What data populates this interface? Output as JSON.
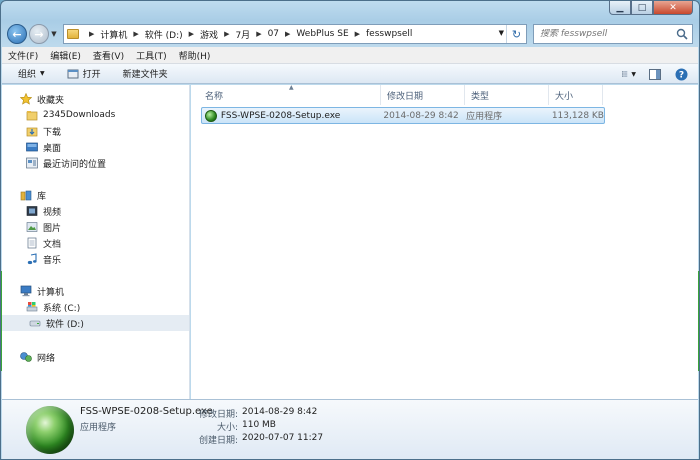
{
  "address": {
    "crumbs": [
      "计算机",
      "软件 (D:)",
      "游戏",
      "7月",
      "07",
      "WebPlus SE",
      "fesswpsell"
    ]
  },
  "search": {
    "placeholder": "搜索 fesswpsell"
  },
  "menu": {
    "items": [
      "文件(F)",
      "编辑(E)",
      "查看(V)",
      "工具(T)",
      "帮助(H)"
    ]
  },
  "toolbar": {
    "organize": "组织",
    "open": "打开",
    "new_folder": "新建文件夹"
  },
  "nav": {
    "favorites": {
      "label": "收藏夹",
      "items": [
        "2345Downloads",
        "下载",
        "桌面",
        "最近访问的位置"
      ]
    },
    "libraries": {
      "label": "库",
      "items": [
        "视频",
        "图片",
        "文档",
        "音乐"
      ]
    },
    "computer": {
      "label": "计算机",
      "items": [
        "系统 (C:)",
        "软件 (D:)"
      ]
    },
    "network": {
      "label": "网络"
    }
  },
  "columns": [
    "名称",
    "修改日期",
    "类型",
    "大小"
  ],
  "files": [
    {
      "name": "FSS-WPSE-0208-Setup.exe",
      "modified": "2014-08-29 8:42",
      "type": "应用程序",
      "size": "113,128 KB"
    }
  ],
  "details": {
    "name": "FSS-WPSE-0208-Setup.exe",
    "type": "应用程序",
    "modified_label": "修改日期:",
    "modified": "2014-08-29 8:42",
    "size_label": "大小:",
    "size": "110 MB",
    "created_label": "创建日期:",
    "created": "2020-07-07 11:27"
  },
  "colors": {
    "accent": "#2b6fb4",
    "selection": "#cbe4f8",
    "chrome": "#bcd9ec"
  }
}
